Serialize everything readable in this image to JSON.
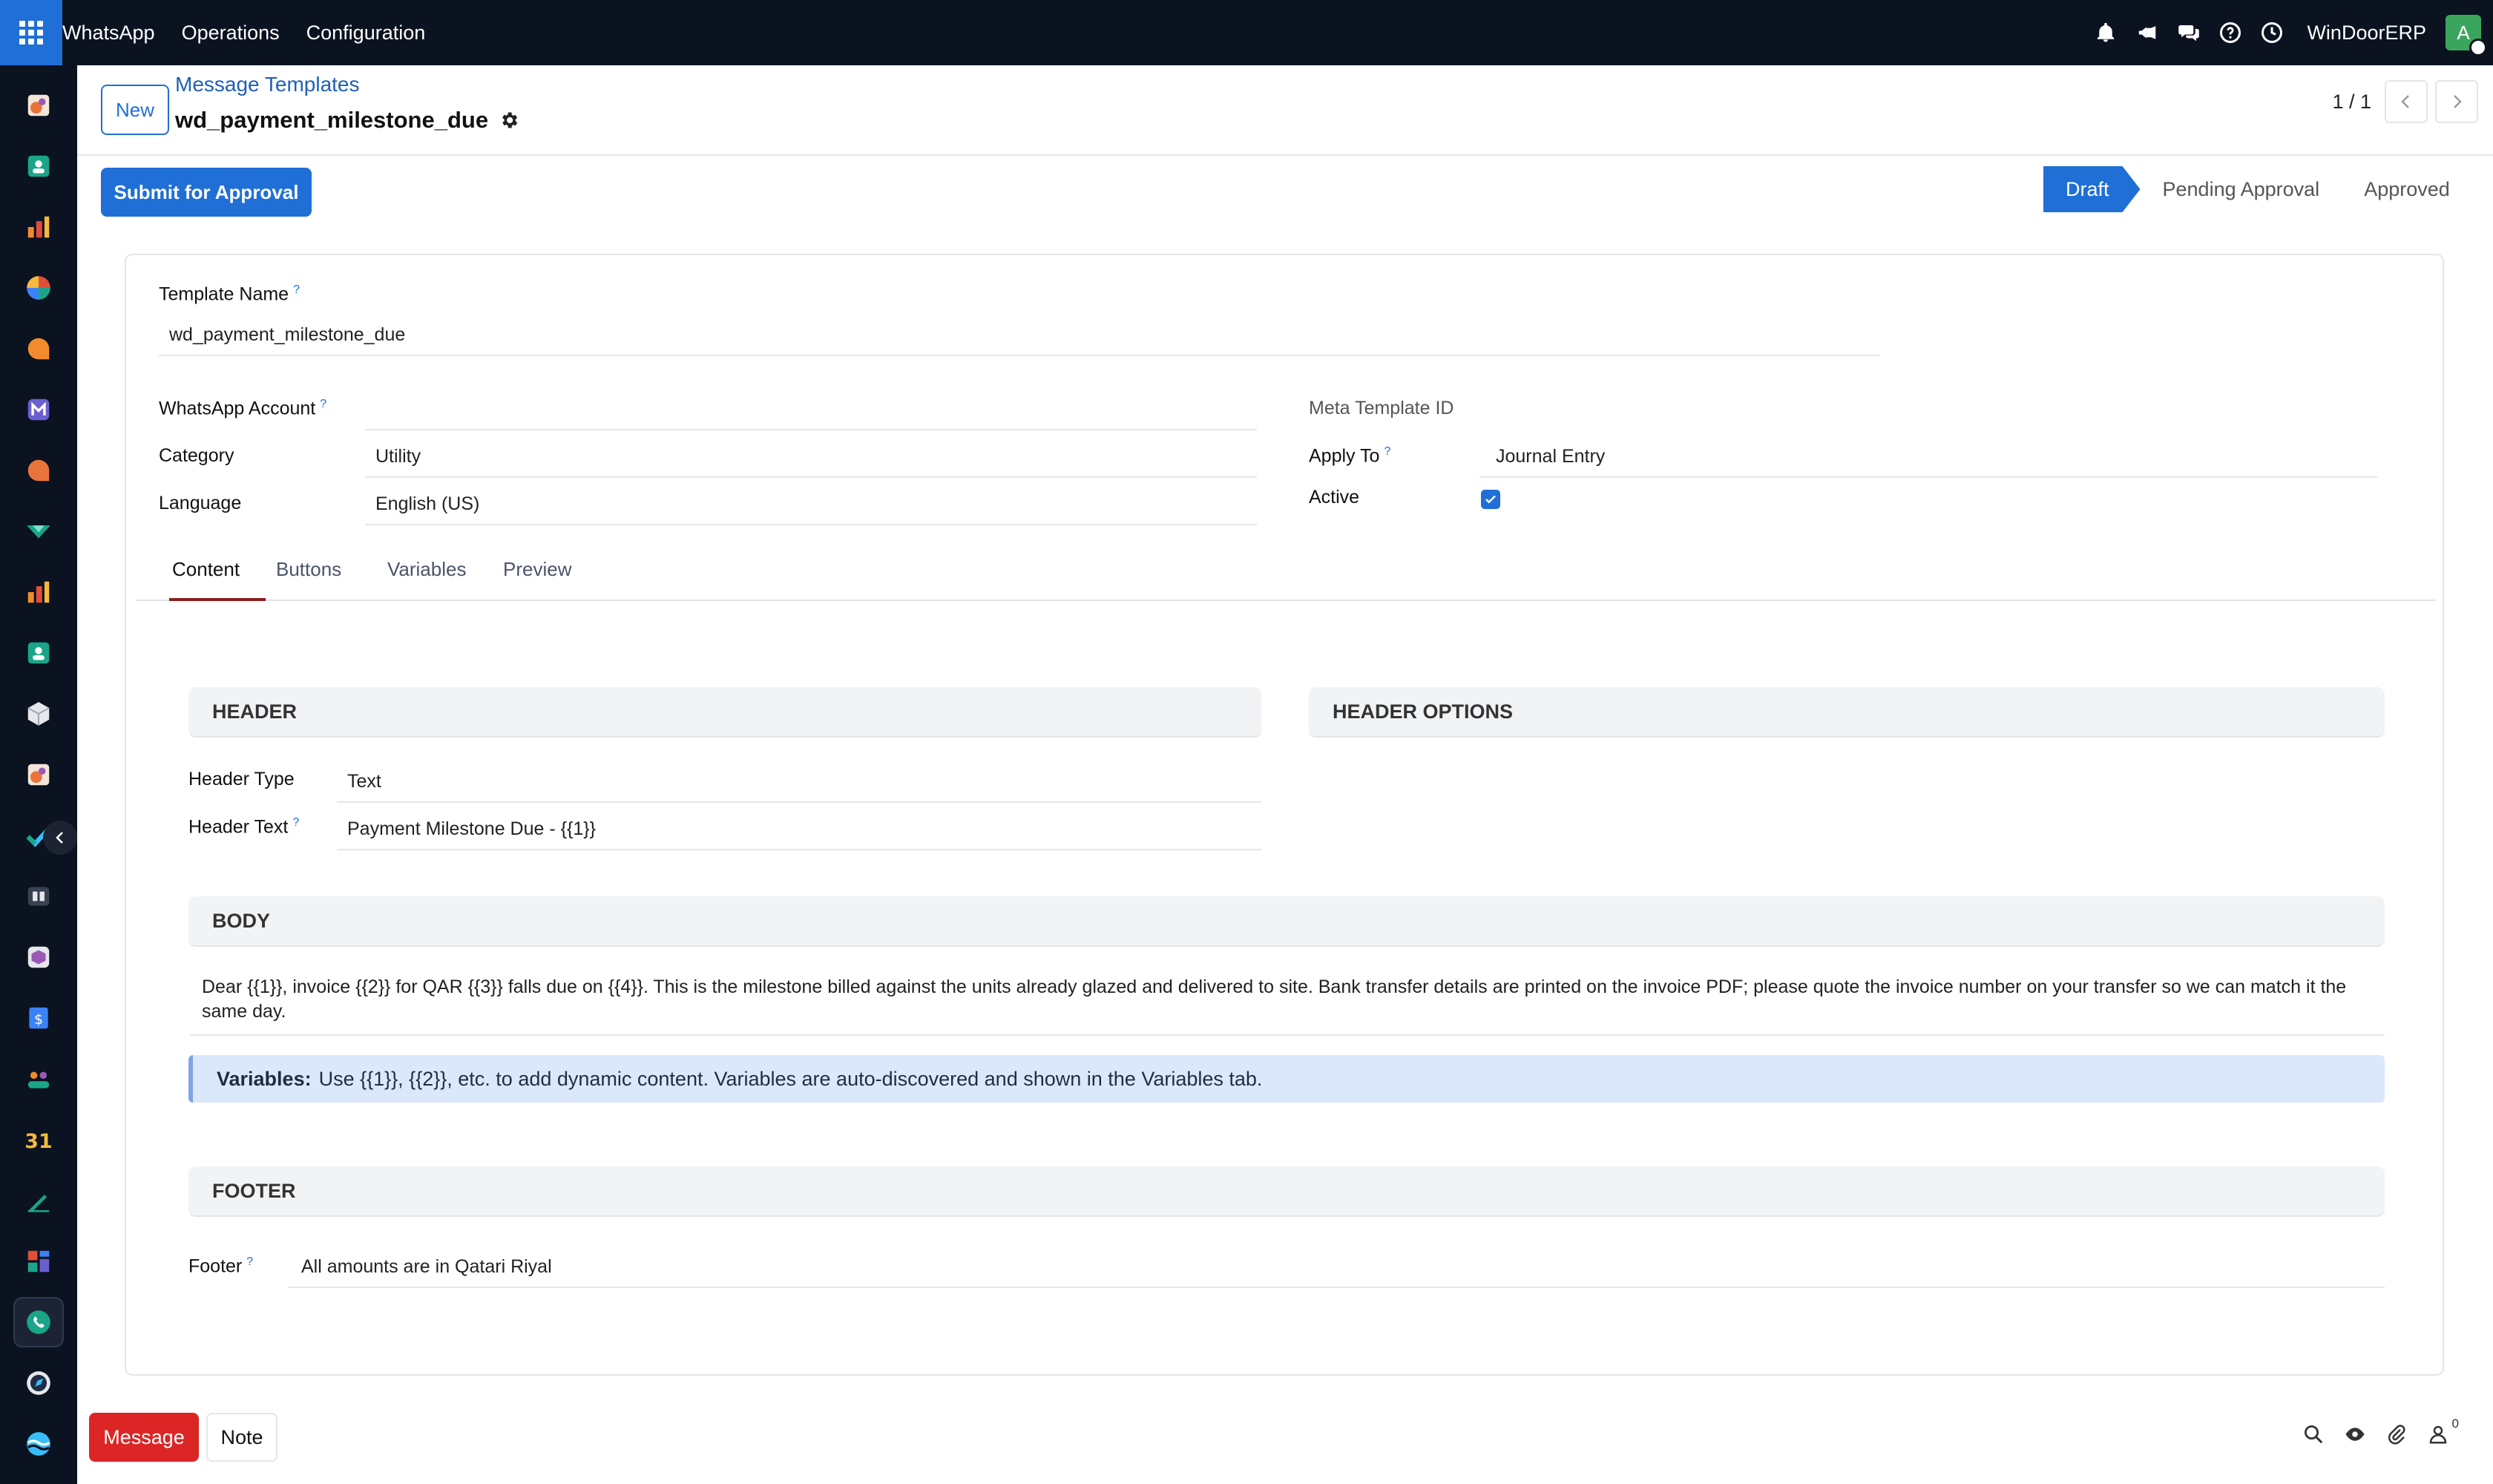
{
  "topbar": {
    "brand": "WhatsApp",
    "menu": [
      "Operations",
      "Configuration"
    ],
    "company": "WinDoorERP",
    "avatar_letter": "A"
  },
  "control": {
    "new_label": "New",
    "breadcrumb": "Message Templates",
    "record_name": "wd_payment_milestone_due",
    "pager": "1 / 1"
  },
  "statusbar": {
    "submit_label": "Submit for Approval",
    "stages": [
      "Draft",
      "Pending Approval",
      "Approved"
    ],
    "current": "Draft"
  },
  "form": {
    "template_name_label": "Template Name",
    "template_name": "wd_payment_milestone_due",
    "whatsapp_account_label": "WhatsApp Account",
    "whatsapp_account": "",
    "category_label": "Category",
    "category": "Utility",
    "language_label": "Language",
    "language": "English (US)",
    "meta_template_id_label": "Meta Template ID",
    "apply_to_label": "Apply To",
    "apply_to": "Journal Entry",
    "active_label": "Active",
    "active": true
  },
  "tabs": [
    "Content",
    "Buttons",
    "Variables",
    "Preview"
  ],
  "content": {
    "header_section": "HEADER",
    "header_options_section": "HEADER OPTIONS",
    "header_type_label": "Header Type",
    "header_type": "Text",
    "header_text_label": "Header Text",
    "header_text": "Payment Milestone Due - {{1}}",
    "body_section": "BODY",
    "body_text": "Dear {{1}}, invoice {{2}} for QAR {{3}} falls due on {{4}}. This is the milestone billed against the units already glazed and delivered to site. Bank transfer details are printed on the invoice PDF; please quote the invoice number on your transfer so we can match it the same day.",
    "alert_label": "Variables:",
    "alert_text": "Use {{1}}, {{2}}, etc. to add dynamic content. Variables are auto-discovered and shown in the Variables tab.",
    "footer_section": "FOOTER",
    "footer_label": "Footer",
    "footer_text": "All amounts are in Qatari Riyal"
  },
  "chatter": {
    "message_label": "Message",
    "note_label": "Note",
    "followers": "0"
  },
  "colors": {
    "primary": "#1f6fd6",
    "danger": "#dc2626",
    "navbar": "#0b1220",
    "alert_bg": "#dbe8fb"
  }
}
